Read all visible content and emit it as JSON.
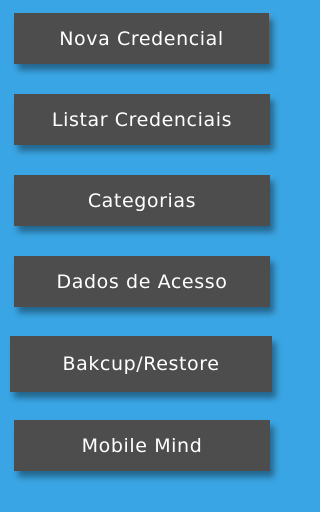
{
  "menu": {
    "items": [
      {
        "label": "Nova Credencial"
      },
      {
        "label": "Listar Credenciais"
      },
      {
        "label": "Categorias"
      },
      {
        "label": "Dados de Acesso"
      },
      {
        "label": "Bakcup/Restore"
      },
      {
        "label": "Mobile Mind"
      }
    ]
  },
  "colors": {
    "background": "#3aa5e4",
    "button": "#4d4d4d",
    "button_text": "#ffffff"
  }
}
